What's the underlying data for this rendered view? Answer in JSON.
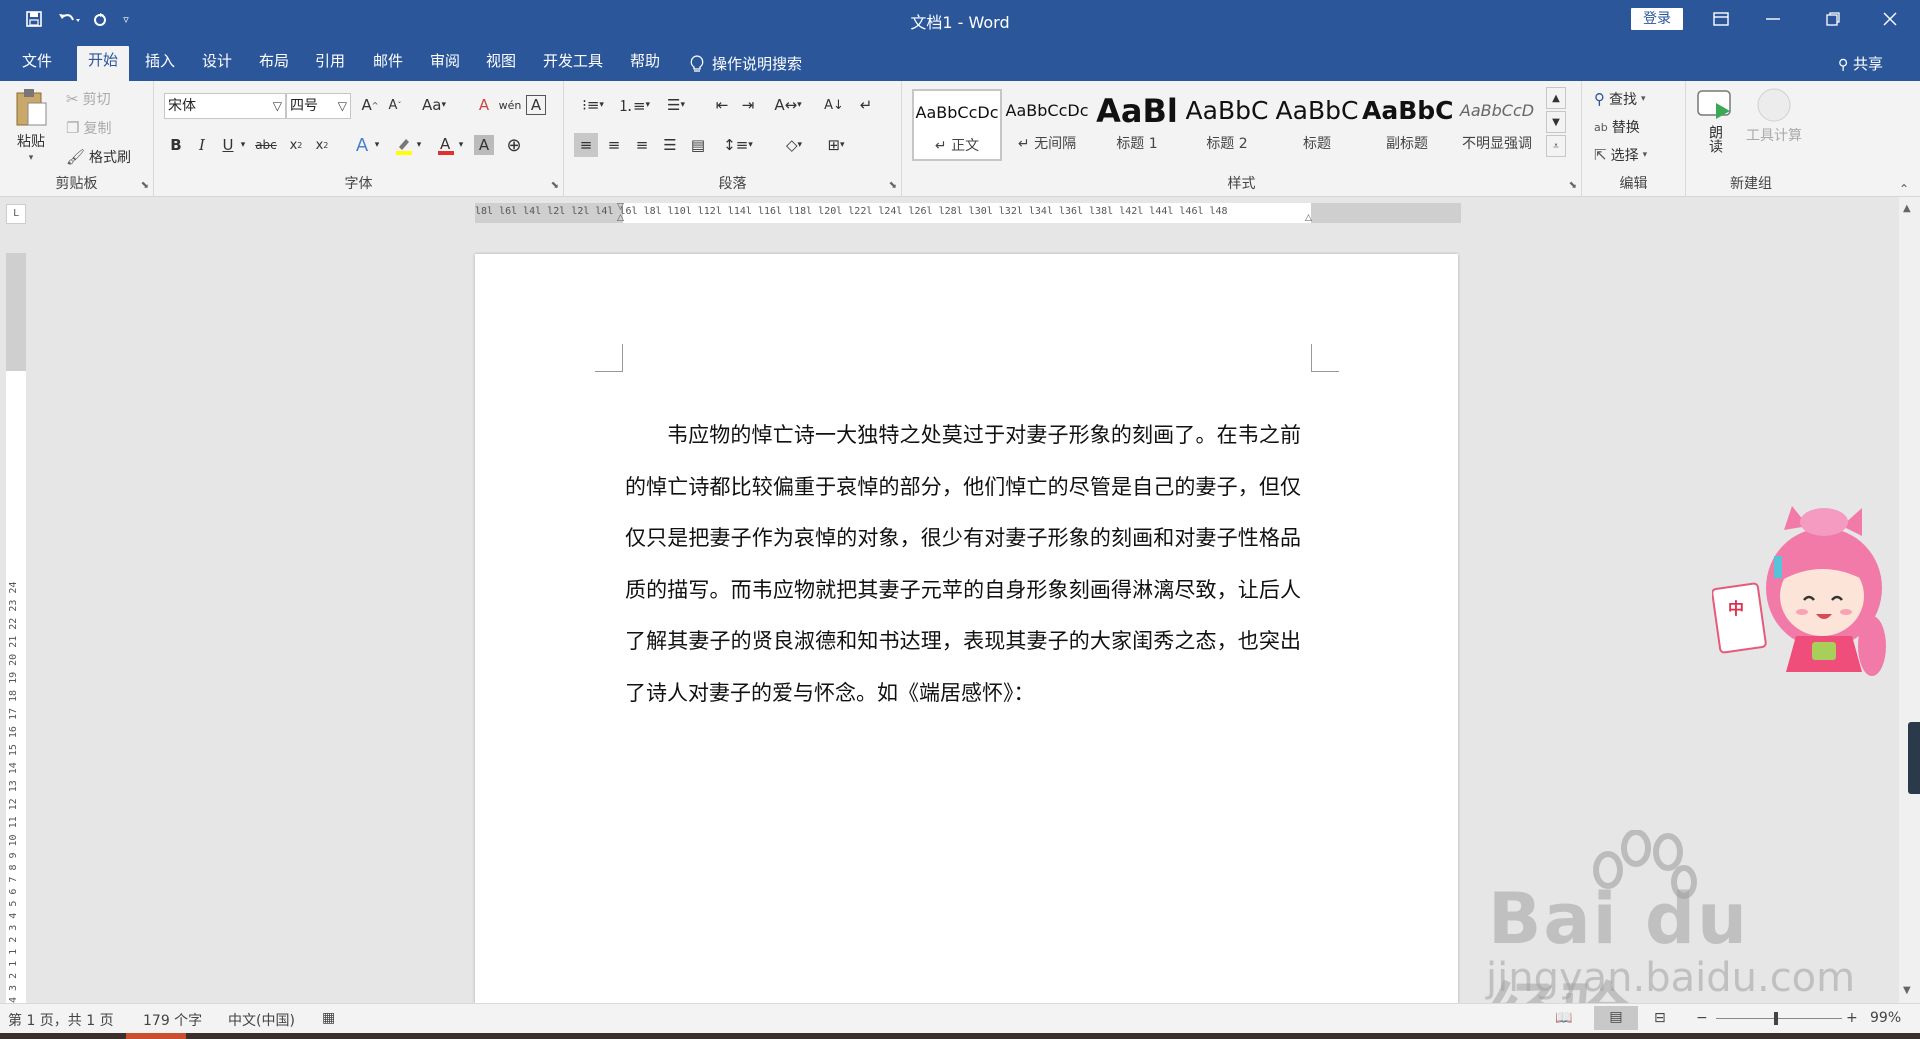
{
  "window": {
    "title": "文档1 - Word",
    "login_label": "登录"
  },
  "qat": {
    "save_icon": "save-icon",
    "undo_icon": "undo-icon",
    "redo_icon": "redo-icon",
    "customize_icon": "customize-qat-icon"
  },
  "tabs": [
    "文件",
    "开始",
    "插入",
    "设计",
    "布局",
    "引用",
    "邮件",
    "审阅",
    "视图",
    "开发工具",
    "帮助"
  ],
  "active_tab": "开始",
  "tell_me": "操作说明搜索",
  "share": "共享",
  "clipboard": {
    "label": "剪贴板",
    "paste": "粘贴",
    "cut": "剪切",
    "copy": "复制",
    "format_painter": "格式刷"
  },
  "font": {
    "label": "字体",
    "font_name": "宋体",
    "font_size": "四号",
    "case_label": "Aa"
  },
  "paragraph": {
    "label": "段落"
  },
  "styles": {
    "label": "样式",
    "items": [
      {
        "sample": "AaBbCcDc",
        "name": "↵ 正文"
      },
      {
        "sample": "AaBbCcDc",
        "name": "↵ 无间隔"
      },
      {
        "sample": "AaBl",
        "name": "标题 1"
      },
      {
        "sample": "AaBbC",
        "name": "标题 2"
      },
      {
        "sample": "AaBbC",
        "name": "标题"
      },
      {
        "sample": "AaBbC",
        "name": "副标题"
      },
      {
        "sample": "AaBbCcD",
        "name": "不明显强调"
      }
    ]
  },
  "editing": {
    "label": "编辑",
    "find": "查找",
    "replace": "替换",
    "select": "选择"
  },
  "newgroup": {
    "label": "新建组",
    "read_aloud": "朗读",
    "tool_calc": "工具计算"
  },
  "ruler": {
    "h_ticks": "l8l l6l l4l l2l     l2l l4l l6l l8l l10l l12l l14l l16l l18l l20l l22l l24l l26l l28l l30l l32l l34l l36l l38l     l42l l44l l46l l48",
    "v_ticks": "4 3 2 1   1 2 3 4 5 6 7 8 9 10 11 12 13 14 15 16 17 18 19 20 21 22 23 24",
    "corner": "L"
  },
  "document": {
    "paragraph": "韦应物的悼亡诗一大独特之处莫过于对妻子形象的刻画了。在韦之前的悼亡诗都比较偏重于哀悼的部分，他们悼亡的尽管是自己的妻子，但仅仅只是把妻子作为哀悼的对象，很少有对妻子形象的刻画和对妻子性格品质的描写。而韦应物就把其妻子元苹的自身形象刻画得淋漓尽致，让后人了解其妻子的贤良淑德和知书达理，表现其妻子的大家闺秀之态，也突出了诗人对妻子的爱与怀念。如《端居感怀》："
  },
  "watermark": {
    "brand": "Bai du 经验",
    "url": "jingyan.baidu.com"
  },
  "status": {
    "page": "第 1 页，共 1 页",
    "words": "179 个字",
    "language": "中文(中国)",
    "zoom": "99%",
    "zoom_value": 99
  },
  "colors": {
    "accent": "#2b579a",
    "font_color": "#e03030",
    "highlight": "#ffff00"
  }
}
